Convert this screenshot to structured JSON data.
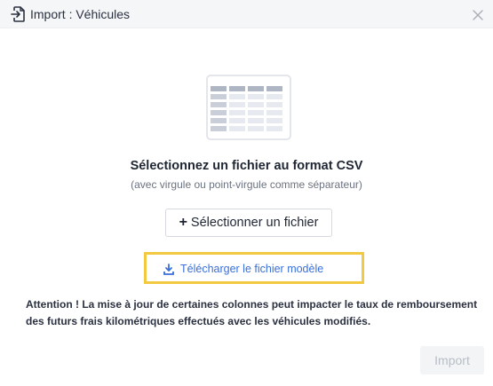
{
  "dialog": {
    "title": "Import : Véhicules",
    "header_icon": "file-import-icon",
    "close_icon": "close-icon"
  },
  "content": {
    "illustration": "csv-table-illustration",
    "title": "Sélectionnez un fichier au format CSV",
    "subtitle": "(avec virgule ou point-virgule comme séparateur)",
    "select_button": {
      "icon": "plus",
      "label": "Sélectionner un fichier"
    },
    "download_link": {
      "icon": "download-icon",
      "label": "Télécharger le fichier modèle"
    },
    "warning": "Attention ! La mise à jour de certaines colonnes peut impacter le taux de remboursement des futurs frais kilométriques effectués avec les véhicules modifiés."
  },
  "footer": {
    "import_label": "Import",
    "import_disabled": true
  },
  "colors": {
    "link": "#3a6fd8",
    "highlight_border": "#f2c940",
    "header_bg": "#f5f6f8"
  }
}
